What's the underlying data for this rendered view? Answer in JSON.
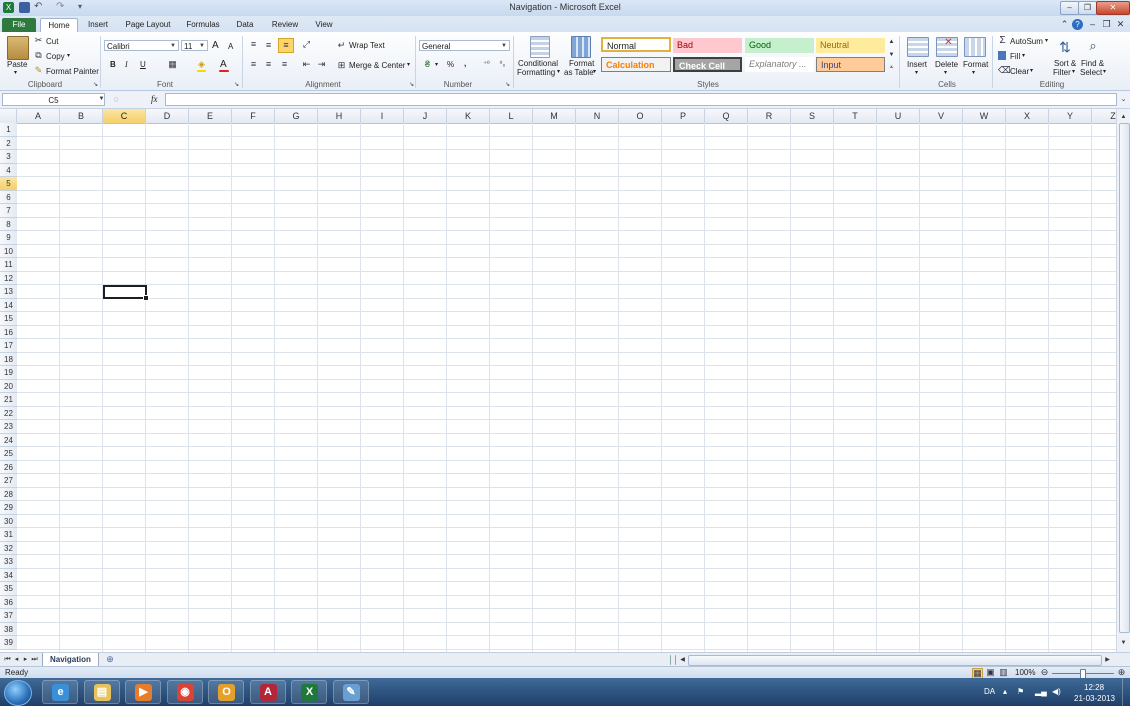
{
  "window": {
    "title": "Navigation - Microsoft Excel",
    "controls": {
      "minimize": "–",
      "restore": "❐",
      "close": "✕"
    },
    "workbook_controls": {
      "help": "?",
      "minimize": "–",
      "restore": "❐",
      "close": "✕",
      "collapse": "⌂"
    }
  },
  "tabs": [
    "File",
    "Home",
    "Insert",
    "Page Layout",
    "Formulas",
    "Data",
    "Review",
    "View"
  ],
  "ribbon": {
    "clipboard": {
      "label": "Clipboard",
      "paste": "Paste",
      "cut": "Cut",
      "copy": "Copy",
      "format_painter": "Format Painter"
    },
    "font": {
      "label": "Font",
      "font_name": "Calibri",
      "font_size": "11",
      "bold": "B",
      "italic": "I",
      "underline": "U",
      "grow": "A",
      "shrink": "A",
      "font_color": "A"
    },
    "alignment": {
      "label": "Alignment",
      "wrap_text": "Wrap Text",
      "merge_center": "Merge & Center"
    },
    "number": {
      "label": "Number",
      "format": "General",
      "percent": "%",
      "comma": ","
    },
    "styles": {
      "label": "Styles",
      "conditional_formatting": [
        "Conditional",
        "Formatting"
      ],
      "format_as_table": [
        "Format",
        "as Table"
      ],
      "cells": [
        {
          "name": "Normal",
          "bg": "#ffffff",
          "color": "#222222",
          "border": "#e0b43c"
        },
        {
          "name": "Bad",
          "bg": "#ffc7ce",
          "color": "#9c0006",
          "border": "#ffc7ce"
        },
        {
          "name": "Good",
          "bg": "#c6efce",
          "color": "#006100",
          "border": "#c6efce"
        },
        {
          "name": "Neutral",
          "bg": "#ffeb9c",
          "color": "#9c6500",
          "border": "#ffeb9c"
        },
        {
          "name": "Calculation",
          "bg": "#f2f2f2",
          "color": "#fa7d00",
          "border": "#7f7f7f"
        },
        {
          "name": "Check Cell",
          "bg": "#a5a5a5",
          "color": "#ffffff",
          "border": "#3f3f3f"
        },
        {
          "name": "Explanatory ...",
          "bg": "#ffffff",
          "color": "#7f7f7f",
          "border": "#ffffff"
        },
        {
          "name": "Input",
          "bg": "#ffcc99",
          "color": "#3f3f76",
          "border": "#7f7f7f"
        }
      ]
    },
    "cells_group": {
      "label": "Cells",
      "insert": "Insert",
      "delete": "Delete",
      "format": "Format"
    },
    "editing": {
      "label": "Editing",
      "autosum": "AutoSum",
      "fill": "Fill",
      "clear": "Clear",
      "sort_filter": [
        "Sort &",
        "Filter"
      ],
      "find_select": [
        "Find &",
        "Select"
      ]
    }
  },
  "formula_bar": {
    "name_box": "C5",
    "fx": "fx",
    "value": ""
  },
  "sheet": {
    "columns": [
      "A",
      "B",
      "C",
      "D",
      "E",
      "F",
      "G",
      "H",
      "I",
      "J",
      "K",
      "L",
      "M",
      "N",
      "O",
      "P",
      "Q",
      "R",
      "S",
      "T",
      "U",
      "V",
      "W",
      "X",
      "Y",
      "Z"
    ],
    "row_count": 39,
    "active_cell": "C5",
    "active_col": "C",
    "active_row": 5
  },
  "sheet_tabs": [
    "Navigation"
  ],
  "status": {
    "text": "Ready",
    "zoom": "100%"
  },
  "taskbar": {
    "apps": [
      {
        "name": "internet-explorer",
        "glyph": "e",
        "color": "#3a8fd9"
      },
      {
        "name": "file-explorer",
        "glyph": "▤",
        "color": "#e8c25a"
      },
      {
        "name": "media-player",
        "glyph": "▶",
        "color": "#e77c2b"
      },
      {
        "name": "chrome",
        "glyph": "◉",
        "color": "#d94437"
      },
      {
        "name": "outlook",
        "glyph": "O",
        "color": "#e5a02b"
      },
      {
        "name": "access",
        "glyph": "A",
        "color": "#b3263a"
      },
      {
        "name": "excel",
        "glyph": "X",
        "color": "#1f7a3a"
      },
      {
        "name": "paint",
        "glyph": "✎",
        "color": "#6a9fd2"
      }
    ],
    "language": "DA",
    "time": "12:28",
    "date": "21-03-2013"
  }
}
